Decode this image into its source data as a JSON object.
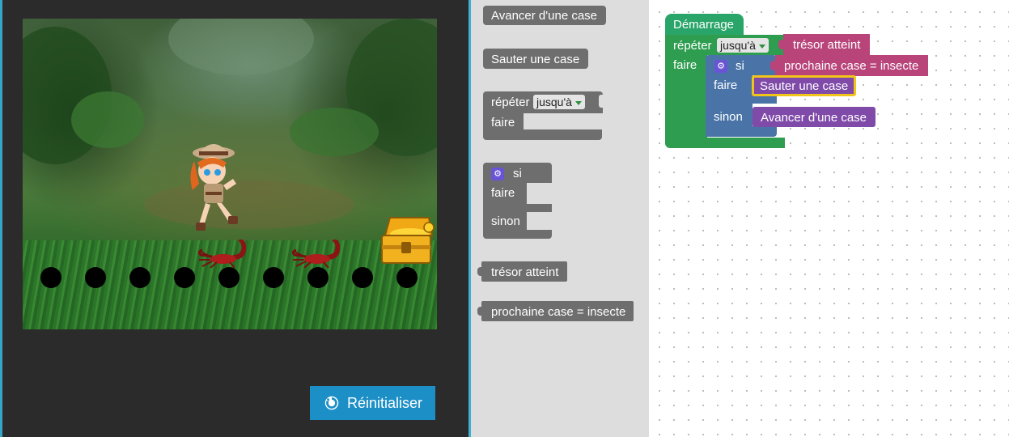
{
  "game": {
    "reset_label": "Réinitialiser",
    "path_dots": 9
  },
  "toolbox": {
    "move_forward": "Avancer d'une case",
    "jump": "Sauter une case",
    "repeat_label": "répéter",
    "repeat_mode": "jusqu'à",
    "do_label": "faire",
    "if_label": "si",
    "else_label": "sinon",
    "treasure_reached": "trésor atteint",
    "next_is_insect": "prochaine case = insecte"
  },
  "workspace": {
    "start_label": "Démarrage",
    "repeat_label": "répéter",
    "repeat_mode": "jusqu'à",
    "condition": "trésor atteint",
    "do_label": "faire",
    "if_label": "si",
    "if_condition": "prochaine case = insecte",
    "if_do_label": "faire",
    "if_do_action": "Sauter une case",
    "else_label": "sinon",
    "else_action": "Avancer d'une case"
  },
  "colors": {
    "accent": "#1d8fc7",
    "start_block": "#2aa56a",
    "loop_block": "#2e9d4f",
    "if_block": "#4a74a8",
    "condition_block": "#b8447a",
    "action_block": "#7f4aa8",
    "selected_outline": "#f0c419"
  }
}
